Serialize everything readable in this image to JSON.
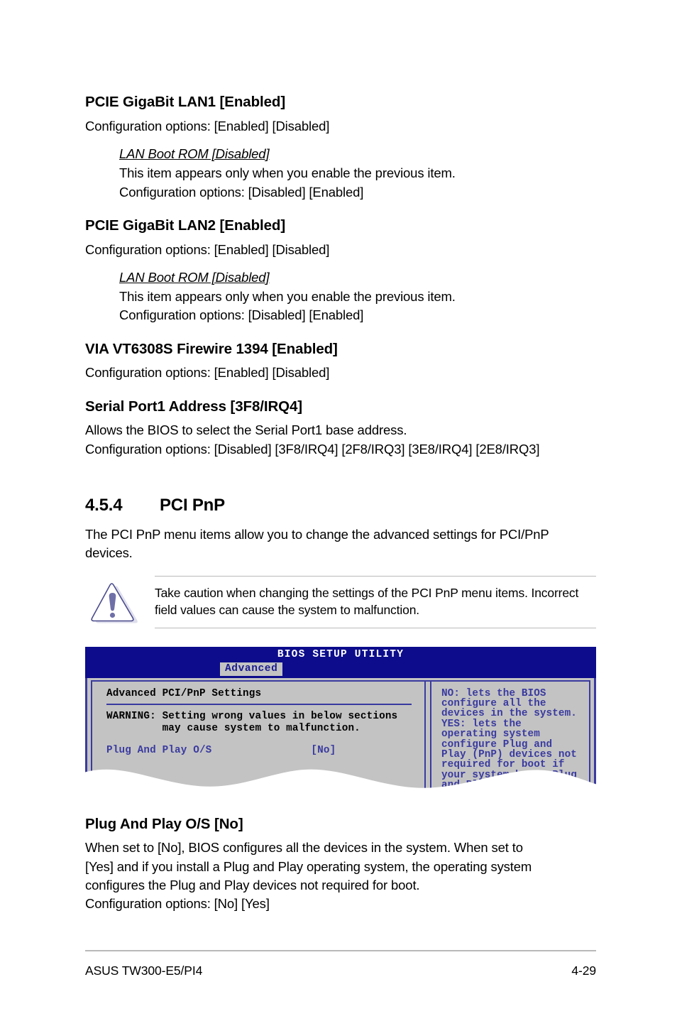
{
  "colors": {
    "bios_header_bg": "#0c0c8c",
    "bios_panel_bg": "#c3c3c3",
    "bios_border": "#3a3aa0",
    "bios_text_blue": "#3a3aa0",
    "note_rule": "#b9b9b9",
    "icon_purple": "#6f6fa8"
  },
  "items": [
    {
      "heading": "PCIE GigaBit LAN1 [Enabled]",
      "body": "Configuration options: [Enabled] [Disabled]",
      "sub": {
        "title": "LAN Boot ROM [Disabled]",
        "line1": "This item appears only when you enable the previous item.",
        "line2": "Configuration options: [Disabled] [Enabled]"
      }
    },
    {
      "heading": "PCIE GigaBit LAN2 [Enabled]",
      "body": "Configuration options: [Enabled] [Disabled]",
      "sub": {
        "title": "LAN Boot ROM [Disabled]",
        "line1": "This item appears only when you enable the previous item.",
        "line2": "Configuration options: [Disabled] [Enabled]"
      }
    },
    {
      "heading": "VIA VT6308S Firewire 1394 [Enabled]",
      "body": "Configuration options: [Enabled] [Disabled]"
    },
    {
      "heading": "Serial Port1 Address [3F8/IRQ4]",
      "body_line1": "Allows the BIOS to select the Serial Port1 base address.",
      "body_line2": "Configuration options: [Disabled] [3F8/IRQ4] [2F8/IRQ3] [3E8/IRQ4] [2E8/IRQ3]"
    }
  ],
  "section": {
    "number": "4.5.4",
    "title": "PCI PnP",
    "intro": "The PCI PnP menu items allow you to change the advanced settings for PCI/PnP devices."
  },
  "note": {
    "icon": "caution-triangle-icon",
    "text": "Take caution when changing the settings of the PCI PnP menu items. Incorrect field values can cause the system to malfunction."
  },
  "bios": {
    "title": "BIOS SETUP UTILITY",
    "tab": "Advanced",
    "panel_heading": "Advanced PCI/PnP Settings",
    "warning_line1": "WARNING: Setting wrong values in below sections",
    "warning_line2": "         may cause system to malfunction.",
    "setting": {
      "label": "Plug And Play O/S",
      "value": "[No]"
    },
    "help": "NO: lets the BIOS\nconfigure all the\ndevices in the system.\nYES: lets the\noperating system\nconfigure Plug and\nPlay (PnP) devices not\nrequired for boot if\nyour system has a Plug\nand Play operating\nsystem."
  },
  "final": {
    "heading": "Plug And Play O/S [No]",
    "line1": "When set to [No], BIOS configures all the devices in the system. When set to",
    "line2": "[Yes] and if you install a Plug and Play operating system, the operating system",
    "line3": "configures the Plug and Play devices not required for boot.",
    "line4": "Configuration options: [No] [Yes]"
  },
  "footer": {
    "product": "ASUS TW300-E5/PI4",
    "page": "4-29"
  }
}
